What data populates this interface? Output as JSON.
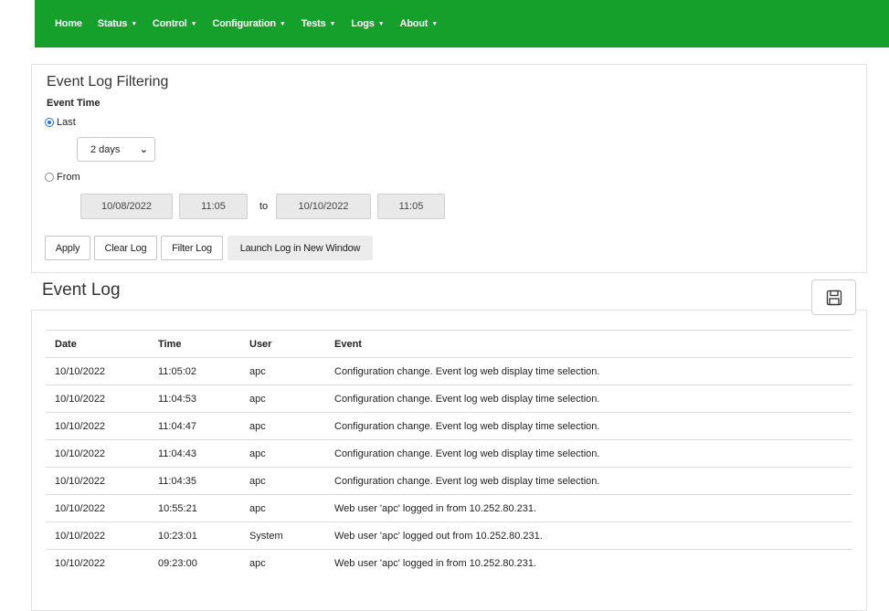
{
  "nav": {
    "items": [
      {
        "label": "Home",
        "caret": false
      },
      {
        "label": "Status",
        "caret": true
      },
      {
        "label": "Control",
        "caret": true
      },
      {
        "label": "Configuration",
        "caret": true
      },
      {
        "label": "Tests",
        "caret": true
      },
      {
        "label": "Logs",
        "caret": true
      },
      {
        "label": "About",
        "caret": true
      }
    ],
    "caret_glyph": "▼",
    "bg_color": "#14a02a"
  },
  "filter": {
    "title": "Event Log Filtering",
    "event_time_label": "Event Time",
    "last_label": "Last",
    "last_checked": true,
    "last_value": "2 days",
    "from_label": "From",
    "from_checked": false,
    "from_date": "10/08/2022",
    "from_time": "11:05",
    "to_label": "to",
    "to_date": "10/10/2022",
    "to_time": "11:05",
    "buttons": {
      "apply": "Apply",
      "clear": "Clear Log",
      "filter": "Filter Log",
      "launch": "Launch Log in New Window"
    }
  },
  "log": {
    "title": "Event Log",
    "save_icon": "floppy-disk-icon",
    "columns": [
      "Date",
      "Time",
      "User",
      "Event"
    ],
    "rows": [
      [
        "10/10/2022",
        "11:05:02",
        "apc",
        "Configuration change. Event log web display time selection."
      ],
      [
        "10/10/2022",
        "11:04:53",
        "apc",
        "Configuration change. Event log web display time selection."
      ],
      [
        "10/10/2022",
        "11:04:47",
        "apc",
        "Configuration change. Event log web display time selection."
      ],
      [
        "10/10/2022",
        "11:04:43",
        "apc",
        "Configuration change. Event log web display time selection."
      ],
      [
        "10/10/2022",
        "11:04:35",
        "apc",
        "Configuration change. Event log web display time selection."
      ],
      [
        "10/10/2022",
        "10:55:21",
        "apc",
        "Web user 'apc' logged in from 10.252.80.231."
      ],
      [
        "10/10/2022",
        "10:23:01",
        "System",
        "Web user 'apc' logged out from 10.252.80.231."
      ],
      [
        "10/10/2022",
        "09:23:00",
        "apc",
        "Web user 'apc' logged in from 10.252.80.231."
      ]
    ]
  }
}
